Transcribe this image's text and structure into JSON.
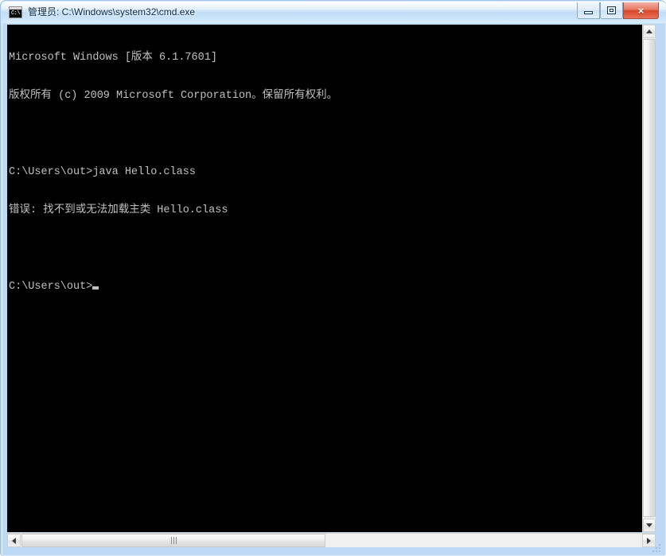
{
  "window": {
    "title": "管理员: C:\\Windows\\system32\\cmd.exe",
    "icon": "cmd-console-icon",
    "icon_glyph": "C:\\",
    "frame_color": "#bcd9f5",
    "titlebar_text_color": "#0a2a4a"
  },
  "caption_buttons": {
    "minimize": {
      "label": "最小化",
      "name": "minimize-button"
    },
    "maximize": {
      "label": "最大化",
      "name": "maximize-restore-button"
    },
    "close": {
      "label": "×",
      "name": "close-button",
      "color": "#d9462b"
    }
  },
  "console": {
    "background": "#000000",
    "foreground": "#c0c0c0",
    "lines": [
      "Microsoft Windows [版本 6.1.7601]",
      "版权所有 (c) 2009 Microsoft Corporation。保留所有权利。",
      "",
      "C:\\Users\\out>java Hello.class",
      "错误: 找不到或无法加载主类 Hello.class",
      ""
    ],
    "prompt": "C:\\Users\\out>",
    "cursor": "block"
  },
  "scrollbars": {
    "vertical": {
      "up_arrow": "▲",
      "down_arrow": "▼",
      "thumb_position": "top"
    },
    "horizontal": {
      "left_arrow": "◄",
      "right_arrow": "►",
      "thumb_position": "left",
      "grip": "|||"
    }
  }
}
